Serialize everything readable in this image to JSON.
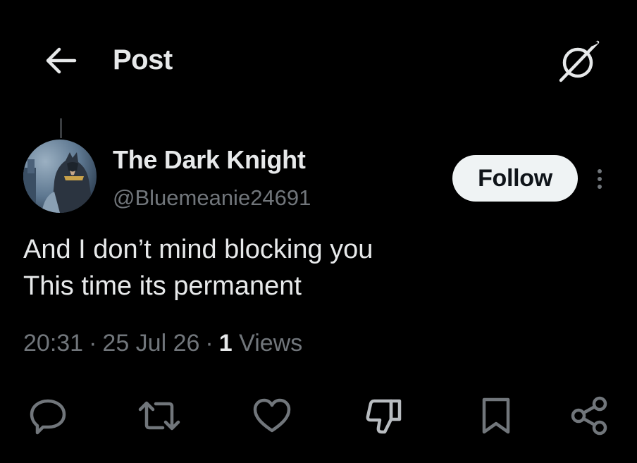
{
  "header": {
    "title": "Post",
    "back_icon": "arrow-left-icon",
    "grok_icon": "grok-icon"
  },
  "post": {
    "author": {
      "display_name": "The Dark Knight",
      "handle": "@Bluemeanie24691",
      "avatar_icon": "batman-avatar"
    },
    "follow_label": "Follow",
    "text_lines": [
      "And I don’t mind blocking you",
      "This time its permanent"
    ],
    "meta": {
      "time": "20:31",
      "separator": "·",
      "date": "25 Jul 26",
      "views_count": "1",
      "views_label": "Views"
    },
    "actions": [
      {
        "name": "reply",
        "icon": "reply-icon"
      },
      {
        "name": "repost",
        "icon": "repost-icon"
      },
      {
        "name": "like",
        "icon": "heart-icon"
      },
      {
        "name": "dislike",
        "icon": "thumbs-down-icon"
      },
      {
        "name": "bookmark",
        "icon": "bookmark-icon"
      },
      {
        "name": "share",
        "icon": "share-icon"
      }
    ]
  },
  "colors": {
    "background": "#000000",
    "text_primary": "#e7e9ea",
    "text_secondary": "#71767b",
    "follow_bg": "#eff3f4",
    "follow_text": "#0f1419"
  }
}
